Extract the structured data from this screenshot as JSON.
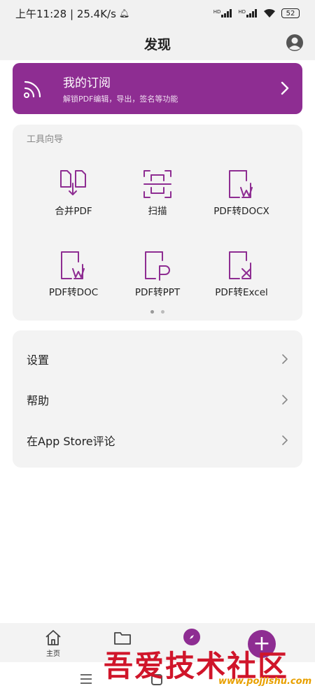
{
  "status_bar": {
    "time_speed": "上午11:28 | 25.4K/s",
    "signal1": "HD",
    "signal2": "HD",
    "battery": "52"
  },
  "header": {
    "title": "发现"
  },
  "subscription": {
    "title": "我的订阅",
    "description": "解锁PDF编辑，导出，签名等功能"
  },
  "tools": {
    "heading": "工具向导",
    "items": [
      {
        "label": "合并PDF",
        "icon": "merge-pdf-icon"
      },
      {
        "label": "扫描",
        "icon": "scan-icon"
      },
      {
        "label": "PDF转DOCX",
        "icon": "pdf-to-docx-icon"
      },
      {
        "label": "PDF转DOC",
        "icon": "pdf-to-doc-icon"
      },
      {
        "label": "PDF转PPT",
        "icon": "pdf-to-ppt-icon"
      },
      {
        "label": "PDF转Excel",
        "icon": "pdf-to-excel-icon"
      }
    ],
    "page_count": 2,
    "active_page": 1
  },
  "settings": {
    "items": [
      {
        "label": "设置"
      },
      {
        "label": "帮助"
      },
      {
        "label": "在App Store评论"
      }
    ]
  },
  "bottom_nav": {
    "home_label": "主页"
  },
  "watermark": {
    "text": "吾爱技术社区",
    "url": "www.pojjishu.com"
  },
  "colors": {
    "accent": "#8e2d92",
    "background": "#f3f3f3"
  }
}
